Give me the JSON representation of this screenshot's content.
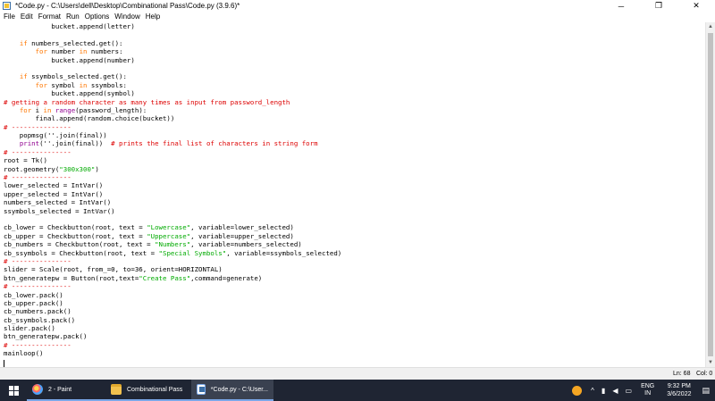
{
  "window": {
    "title": "*Code.py - C:\\Users\\dell\\Desktop\\Combinational Pass\\Code.py (3.9.6)*",
    "minimize_glyph": "─",
    "restore_glyph": "❐",
    "close_glyph": "✕"
  },
  "menu": [
    "File",
    "Edit",
    "Format",
    "Run",
    "Options",
    "Window",
    "Help"
  ],
  "code_lines": [
    [
      {
        "t": "            bucket.append(letter)",
        "c": "pl"
      }
    ],
    [
      {
        "t": "",
        "c": "pl"
      }
    ],
    [
      {
        "t": "    ",
        "c": "pl"
      },
      {
        "t": "if",
        "c": "kw"
      },
      {
        "t": " numbers_selected.get():",
        "c": "pl"
      }
    ],
    [
      {
        "t": "        ",
        "c": "pl"
      },
      {
        "t": "for",
        "c": "kw"
      },
      {
        "t": " number ",
        "c": "pl"
      },
      {
        "t": "in",
        "c": "kw"
      },
      {
        "t": " numbers:",
        "c": "pl"
      }
    ],
    [
      {
        "t": "            bucket.append(number)",
        "c": "pl"
      }
    ],
    [
      {
        "t": "",
        "c": "pl"
      }
    ],
    [
      {
        "t": "    ",
        "c": "pl"
      },
      {
        "t": "if",
        "c": "kw"
      },
      {
        "t": " ssymbols_selected.get():",
        "c": "pl"
      }
    ],
    [
      {
        "t": "        ",
        "c": "pl"
      },
      {
        "t": "for",
        "c": "kw"
      },
      {
        "t": " symbol ",
        "c": "pl"
      },
      {
        "t": "in",
        "c": "kw"
      },
      {
        "t": " ssymbols:",
        "c": "pl"
      }
    ],
    [
      {
        "t": "            bucket.append(symbol)",
        "c": "pl"
      }
    ],
    [
      {
        "t": "# getting a random character as many times as input from password_length",
        "c": "cm"
      }
    ],
    [
      {
        "t": "    ",
        "c": "pl"
      },
      {
        "t": "for",
        "c": "kw"
      },
      {
        "t": " i ",
        "c": "pl"
      },
      {
        "t": "in",
        "c": "kw"
      },
      {
        "t": " ",
        "c": "pl"
      },
      {
        "t": "range",
        "c": "bi"
      },
      {
        "t": "(password_length):",
        "c": "pl"
      }
    ],
    [
      {
        "t": "        final.append(random.choice(bucket))",
        "c": "pl"
      }
    ],
    [
      {
        "t": "# ---------------",
        "c": "cm"
      }
    ],
    [
      {
        "t": "    popmsg(''.join(final))",
        "c": "pl"
      }
    ],
    [
      {
        "t": "    ",
        "c": "pl"
      },
      {
        "t": "print",
        "c": "bi"
      },
      {
        "t": "(''.join(final))  ",
        "c": "pl"
      },
      {
        "t": "# prints the final list of characters in string form",
        "c": "cm"
      }
    ],
    [
      {
        "t": "# ---------------",
        "c": "cm"
      }
    ],
    [
      {
        "t": "root = Tk()",
        "c": "pl"
      }
    ],
    [
      {
        "t": "root.geometry(",
        "c": "pl"
      },
      {
        "t": "\"300x300\"",
        "c": "str"
      },
      {
        "t": ")",
        "c": "pl"
      }
    ],
    [
      {
        "t": "# ---------------",
        "c": "cm"
      }
    ],
    [
      {
        "t": "lower_selected = IntVar()",
        "c": "pl"
      }
    ],
    [
      {
        "t": "upper_selected = IntVar()",
        "c": "pl"
      }
    ],
    [
      {
        "t": "numbers_selected = IntVar()",
        "c": "pl"
      }
    ],
    [
      {
        "t": "ssymbols_selected = IntVar()",
        "c": "pl"
      }
    ],
    [
      {
        "t": "",
        "c": "pl"
      }
    ],
    [
      {
        "t": "cb_lower = Checkbutton(root, text = ",
        "c": "pl"
      },
      {
        "t": "\"Lowercase\"",
        "c": "str"
      },
      {
        "t": ", variable=lower_selected)",
        "c": "pl"
      }
    ],
    [
      {
        "t": "cb_upper = Checkbutton(root, text = ",
        "c": "pl"
      },
      {
        "t": "\"Uppercase\"",
        "c": "str"
      },
      {
        "t": ", variable=upper_selected)",
        "c": "pl"
      }
    ],
    [
      {
        "t": "cb_numbers = Checkbutton(root, text = ",
        "c": "pl"
      },
      {
        "t": "\"Numbers\"",
        "c": "str"
      },
      {
        "t": ", variable=numbers_selected)",
        "c": "pl"
      }
    ],
    [
      {
        "t": "cb_ssymbols = Checkbutton(root, text = ",
        "c": "pl"
      },
      {
        "t": "\"Special Symbols\"",
        "c": "str"
      },
      {
        "t": ", variable=ssymbols_selected)",
        "c": "pl"
      }
    ],
    [
      {
        "t": "# ---------------",
        "c": "cm"
      }
    ],
    [
      {
        "t": "slider = Scale(root, from_=0, to=36, orient=HORIZONTAL)",
        "c": "pl"
      }
    ],
    [
      {
        "t": "btn_generatepw = Button(root,text=",
        "c": "pl"
      },
      {
        "t": "\"Create Pass\"",
        "c": "str"
      },
      {
        "t": ",command=generate)",
        "c": "pl"
      }
    ],
    [
      {
        "t": "# ---------------",
        "c": "cm"
      }
    ],
    [
      {
        "t": "cb_lower.pack()",
        "c": "pl"
      }
    ],
    [
      {
        "t": "cb_upper.pack()",
        "c": "pl"
      }
    ],
    [
      {
        "t": "cb_numbers.pack()",
        "c": "pl"
      }
    ],
    [
      {
        "t": "cb_ssymbols.pack()",
        "c": "pl"
      }
    ],
    [
      {
        "t": "slider.pack()",
        "c": "pl"
      }
    ],
    [
      {
        "t": "btn_generatepw.pack()",
        "c": "pl"
      }
    ],
    [
      {
        "t": "# ---------------",
        "c": "cm"
      }
    ],
    [
      {
        "t": "mainloop()",
        "c": "pl"
      }
    ]
  ],
  "status": {
    "line": "Ln: 68",
    "col": "Col: 0"
  },
  "taskbar": {
    "items": [
      {
        "label": "2 - Paint",
        "icon": "paint-icon"
      },
      {
        "label": "Combinational Pass",
        "icon": "folder-icon"
      },
      {
        "label": "*Code.py - C:\\User...",
        "icon": "python-idle-icon"
      }
    ]
  },
  "tray": {
    "chevron": "^",
    "lang_top": "ENG",
    "lang_bottom": "IN",
    "time": "9:32 PM",
    "date": "3/6/2022"
  },
  "colors": {
    "keyword": "#ff7700",
    "builtin": "#900090",
    "string": "#00aa00",
    "comment": "#dd0000",
    "taskbar": "#1f2533"
  }
}
